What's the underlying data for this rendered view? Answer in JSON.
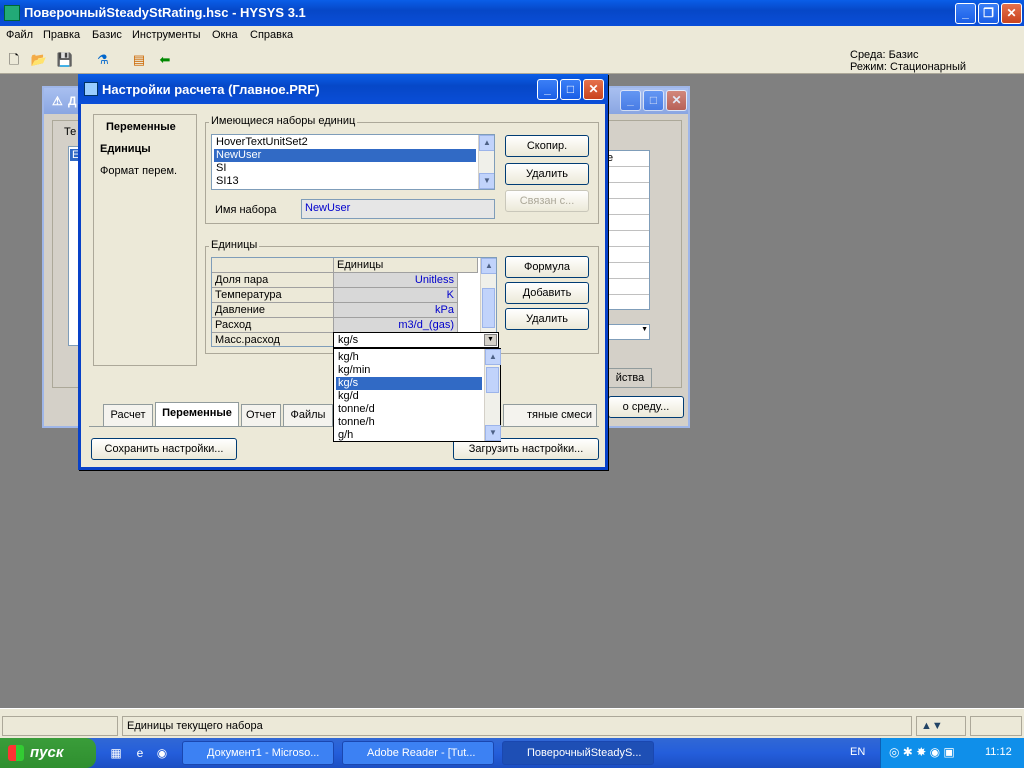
{
  "app": {
    "title": "ПоверочныйSteadyStRating.hsc - HYSYS 3.1",
    "menu": [
      "Файл",
      "Правка",
      "Базис",
      "Инструменты",
      "Окна",
      "Справка"
    ],
    "environment": "Среда: Базис",
    "mode": "Режим: Стационарный"
  },
  "dialog": {
    "title": "Настройки расчета (Главное.PRF)",
    "sidebar": {
      "header": "Переменные",
      "items": [
        "Единицы",
        "Формат перем."
      ]
    },
    "unit_sets": {
      "label": "Имеющиеся наборы единиц",
      "items": [
        "HoverTextUnitSet2",
        "NewUser",
        "SI",
        "SI13"
      ],
      "selected": "NewUser",
      "name_label": "Имя набора",
      "name_value": "NewUser",
      "buttons": {
        "copy": "Скопир.",
        "delete": "Удалить",
        "linked": "Связан с..."
      }
    },
    "units": {
      "label": "Единицы",
      "column_header": "Единицы",
      "rows": [
        {
          "name": "Доля пара",
          "unit": "Unitless"
        },
        {
          "name": "Температура",
          "unit": "K"
        },
        {
          "name": "Давление",
          "unit": "kPa"
        },
        {
          "name": "Расход",
          "unit": "m3/d_(gas)"
        },
        {
          "name": "Масс.расход",
          "unit": "kg/s"
        }
      ],
      "buttons": {
        "formula": "Формула",
        "add": "Добавить",
        "delete": "Удалить"
      },
      "dropdown_options": [
        "kg/h",
        "kg/min",
        "kg/s",
        "kg/d",
        "tonne/d",
        "tonne/h",
        "g/h"
      ],
      "dropdown_selected": "kg/s"
    },
    "tabs": [
      "Расчет",
      "Переменные",
      "Отчет",
      "Файлы"
    ],
    "active_tab": "Переменные",
    "tab_behind_dropdown": "тяные смеси",
    "save_button": "Сохранить настройки...",
    "load_button": "Загрузить настройки..."
  },
  "background_window": {
    "partial_title": "Д",
    "partial_group": "Те",
    "partial_item": "Е",
    "partial_col": "е",
    "partial_tab": "йства",
    "partial_button": "о среду..."
  },
  "statusbar": {
    "text": "Единицы текущего набора"
  },
  "taskbar": {
    "start": "пуск",
    "tasks": [
      "Документ1 - Microso...",
      "Adobe Reader - [Tut...",
      "ПоверочныйSteadyS..."
    ],
    "lang": "EN",
    "clock": "11:12"
  }
}
